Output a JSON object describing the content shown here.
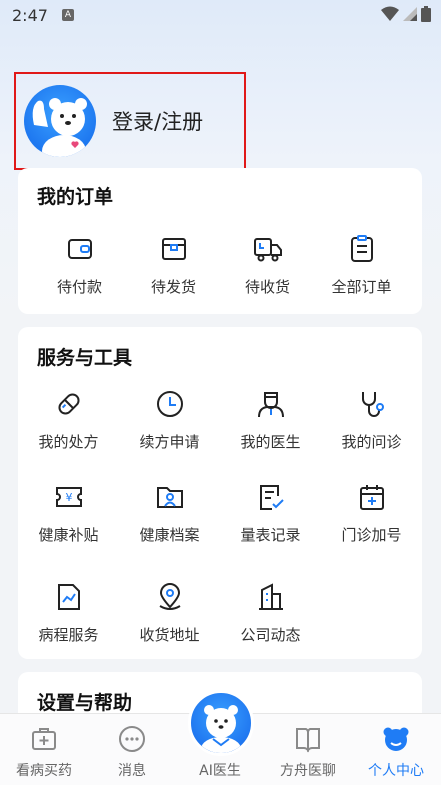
{
  "status_bar": {
    "time": "2:47",
    "notif_glyph": "A"
  },
  "profile": {
    "login_label": "登录/注册"
  },
  "orders": {
    "title": "我的订单",
    "items": [
      {
        "label": "待付款",
        "icon": "wallet-icon"
      },
      {
        "label": "待发货",
        "icon": "package-icon"
      },
      {
        "label": "待收货",
        "icon": "truck-icon"
      },
      {
        "label": "全部订单",
        "icon": "clipboard-icon"
      }
    ]
  },
  "services": {
    "title": "服务与工具",
    "items": [
      {
        "label": "我的处方",
        "icon": "pill-icon"
      },
      {
        "label": "续方申请",
        "icon": "clock-icon"
      },
      {
        "label": "我的医生",
        "icon": "doctor-icon"
      },
      {
        "label": "我的问诊",
        "icon": "stethoscope-icon"
      },
      {
        "label": "健康补贴",
        "icon": "yuan-ticket-icon"
      },
      {
        "label": "健康档案",
        "icon": "folder-user-icon"
      },
      {
        "label": "量表记录",
        "icon": "form-check-icon"
      },
      {
        "label": "门诊加号",
        "icon": "calendar-plus-icon"
      },
      {
        "label": "病程服务",
        "icon": "chart-doc-icon"
      },
      {
        "label": "收货地址",
        "icon": "location-pin-icon"
      },
      {
        "label": "公司动态",
        "icon": "building-icon"
      }
    ]
  },
  "settings": {
    "title": "设置与帮助"
  },
  "bottom_nav": {
    "items": [
      {
        "label": "看病买药",
        "icon": "medkit-icon"
      },
      {
        "label": "消息",
        "icon": "chat-icon"
      },
      {
        "label": "AI医生",
        "icon": "ai-doctor-icon"
      },
      {
        "label": "方舟医聊",
        "icon": "book-icon"
      },
      {
        "label": "个人中心",
        "icon": "bear-icon"
      }
    ],
    "active": "个人中心"
  },
  "colors": {
    "accent": "#1f7cf5",
    "highlight_border": "#e01818"
  }
}
